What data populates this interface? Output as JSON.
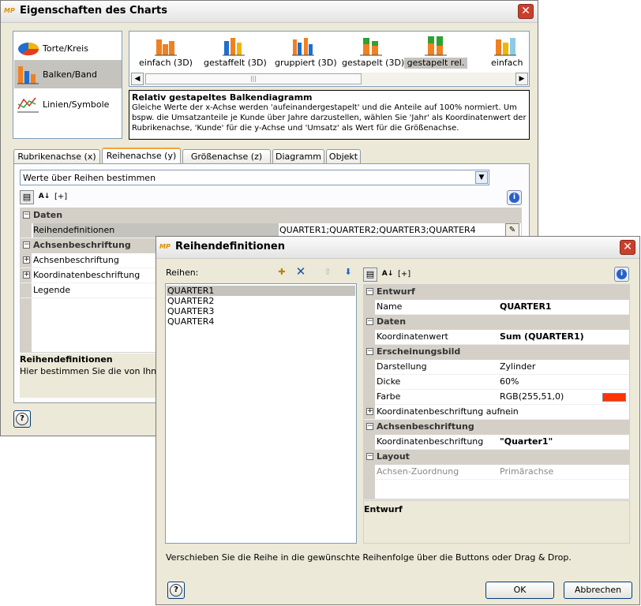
{
  "main_window": {
    "title": "Eigenschaften des Charts",
    "app_icon_text": "MP",
    "chart_types": [
      {
        "label": "Torte/Kreis",
        "icon": "pie-chart-icon"
      },
      {
        "label": "Balken/Band",
        "icon": "bar-chart-icon"
      },
      {
        "label": "Linien/Symbole",
        "icon": "line-chart-icon"
      }
    ],
    "subtypes": [
      {
        "label": "einfach (3D)"
      },
      {
        "label": "gestaffelt (3D)"
      },
      {
        "label": "gruppiert (3D)"
      },
      {
        "label": "gestapelt (3D)"
      },
      {
        "label": "gestapelt rel."
      },
      {
        "label": "einfach"
      }
    ],
    "description_title": "Relativ gestapeltes Balkendiagramm",
    "description_text": "Gleiche Werte der x-Achse werden 'aufeinandergestapelt' und die Anteile auf 100% normiert. Um bspw. die Umsatzanteile je Kunde über Jahre darzustellen, wählen Sie 'Jahr' als Koordinatenwert der Rubrikenachse, 'Kunde' für die y-Achse und 'Umsatz' als Wert für die Größenachse.",
    "tabs": [
      {
        "label": "Rubrikenachse (x)"
      },
      {
        "label": "Reihenachse (y)"
      },
      {
        "label": "Größenachse (z)"
      },
      {
        "label": "Diagramm"
      },
      {
        "label": "Objekt"
      }
    ],
    "combo_value": "Werte über Reihen bestimmen",
    "toolbar_label": "[+]",
    "grid": {
      "cat_daten": "Daten",
      "row_reihendefinitionen": {
        "name": "Reihendefinitionen",
        "value": "QUARTER1;QUARTER2;QUARTER3;QUARTER4"
      },
      "cat_achsen": "Achsenbeschriftung",
      "row_achsenbeschriftung": "Achsenbeschriftung",
      "row_koordinaten": "Koordinatenbeschriftung",
      "row_legende": "Legende"
    },
    "help_title": "Reihendefinitionen",
    "help_text": "Hier bestimmen Sie die von Ihnen ge"
  },
  "dialog": {
    "title": "Reihendefinitionen",
    "reihen_label": "Reihen:",
    "series": [
      "QUARTER1",
      "QUARTER2",
      "QUARTER3",
      "QUARTER4"
    ],
    "toolbar_label": "[+]",
    "props": {
      "cat_entwurf": "Entwurf",
      "name_label": "Name",
      "name_value": "QUARTER1",
      "cat_daten": "Daten",
      "koordinatenwert_label": "Koordinatenwert",
      "koordinatenwert_value": "Sum (QUARTER1)",
      "cat_erscheinung": "Erscheinungsbild",
      "darstellung_label": "Darstellung",
      "darstellung_value": "Zylinder",
      "dicke_label": "Dicke",
      "dicke_value": "60%",
      "farbe_label": "Farbe",
      "farbe_value": "RGB(255,51,0)",
      "farbe_color": "#ff3300",
      "koordbeschr_auf_label": "Koordinatenbeschriftung auf ...",
      "koordbeschr_auf_value": "nein",
      "cat_achsen": "Achsenbeschriftung",
      "koordbeschr_label": "Koordinatenbeschriftung",
      "koordbeschr_value": "\"Quarter1\"",
      "cat_layout": "Layout",
      "achsenzuordnung_label": "Achsen-Zuordnung",
      "achsenzuordnung_value": "Primärachse"
    },
    "desc_title": "Entwurf",
    "hint": "Verschieben Sie die Reihe in die gewünschte Reihenfolge über die Buttons oder Drag & Drop.",
    "ok_label": "OK",
    "cancel_label": "Abbrechen"
  }
}
